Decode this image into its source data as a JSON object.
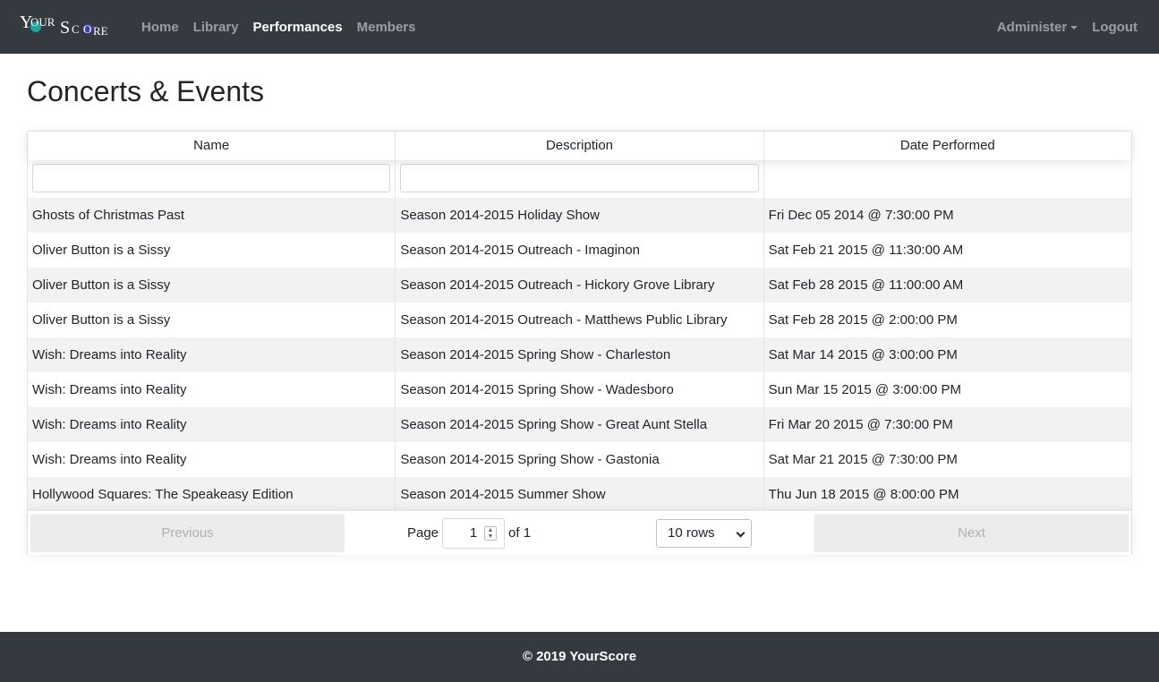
{
  "nav": {
    "brand": "YourScore",
    "links": [
      {
        "label": "Home",
        "active": false
      },
      {
        "label": "Library",
        "active": false
      },
      {
        "label": "Performances",
        "active": true
      },
      {
        "label": "Members",
        "active": false
      }
    ],
    "administer": "Administer",
    "logout": "Logout"
  },
  "page": {
    "title": "Concerts & Events"
  },
  "table": {
    "columns": [
      "Name",
      "Description",
      "Date Performed"
    ],
    "rows": [
      {
        "name": "Ghosts of Christmas Past",
        "description": "Season 2014-2015 Holiday Show",
        "date": "Fri Dec 05 2014 @ 7:30:00 PM"
      },
      {
        "name": "Oliver Button is a Sissy",
        "description": "Season 2014-2015 Outreach - Imaginon",
        "date": "Sat Feb 21 2015 @ 11:30:00 AM"
      },
      {
        "name": "Oliver Button is a Sissy",
        "description": "Season 2014-2015 Outreach - Hickory Grove Library",
        "date": "Sat Feb 28 2015 @ 11:00:00 AM"
      },
      {
        "name": "Oliver Button is a Sissy",
        "description": "Season 2014-2015 Outreach - Matthews Public Library",
        "date": "Sat Feb 28 2015 @ 2:00:00 PM"
      },
      {
        "name": "Wish: Dreams into Reality",
        "description": "Season 2014-2015 Spring Show - Charleston",
        "date": "Sat Mar 14 2015 @ 3:00:00 PM"
      },
      {
        "name": "Wish: Dreams into Reality",
        "description": "Season 2014-2015 Spring Show - Wadesboro",
        "date": "Sun Mar 15 2015 @ 3:00:00 PM"
      },
      {
        "name": "Wish: Dreams into Reality",
        "description": "Season 2014-2015 Spring Show - Great Aunt Stella",
        "date": "Fri Mar 20 2015 @ 7:30:00 PM"
      },
      {
        "name": "Wish: Dreams into Reality",
        "description": "Season 2014-2015 Spring Show - Gastonia",
        "date": "Sat Mar 21 2015 @ 7:30:00 PM"
      },
      {
        "name": "Hollywood Squares: The Speakeasy Edition",
        "description": "Season 2014-2015 Summer Show",
        "date": "Thu Jun 18 2015 @ 8:00:00 PM"
      }
    ]
  },
  "pager": {
    "previous": "Previous",
    "next": "Next",
    "page_label": "Page",
    "page_value": "1",
    "of_label": "of 1",
    "rows_option": "10 rows"
  },
  "footer": {
    "text": "© 2019 YourScore"
  },
  "colors": {
    "navbar": "#343a40",
    "stripe": "#f2f2f2",
    "brand_dot1": "#1fa39a",
    "brand_dot2": "#3b3fbf"
  }
}
